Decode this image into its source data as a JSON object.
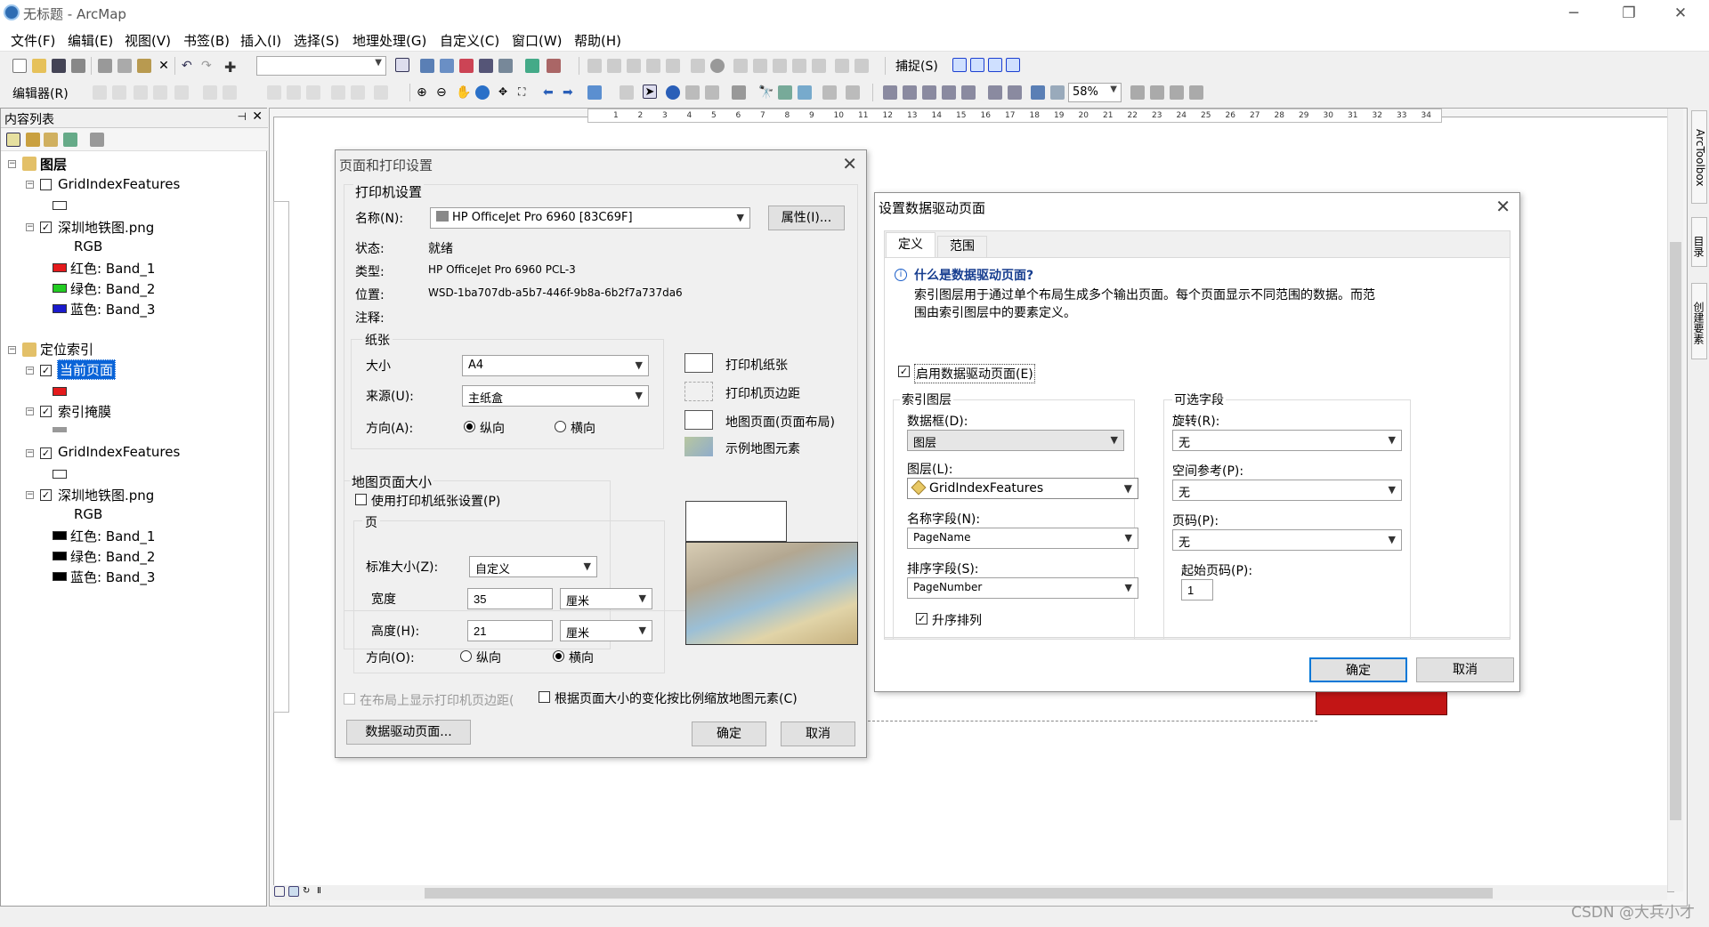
{
  "app": {
    "title": "无标题 - ArcMap",
    "watermark": "CSDN @大兵小才"
  },
  "menu": [
    "文件(F)",
    "编辑(E)",
    "视图(V)",
    "书签(B)",
    "插入(I)",
    "选择(S)",
    "地理处理(G)",
    "自定义(C)",
    "窗口(W)",
    "帮助(H)"
  ],
  "toolbar": {
    "snap_label": "捕捉(S)",
    "editor_label": "编辑器(R)",
    "zoom": "58%"
  },
  "toc": {
    "title": "内容列表",
    "items": [
      {
        "text": "图层",
        "type": "group"
      },
      {
        "text": "GridIndexFeatures"
      },
      {
        "text": "深圳地铁图.png"
      },
      {
        "text": "RGB"
      },
      {
        "text": "红色:   Band_1",
        "color": "#e41a1c"
      },
      {
        "text": "绿色: Band_2",
        "color": "#22cc22"
      },
      {
        "text": "蓝色:   Band_3",
        "color": "#1a1acc"
      },
      {
        "text": "定位索引",
        "type": "group"
      },
      {
        "text": "当前页面",
        "selected": true
      },
      {
        "text": "索引掩膜"
      },
      {
        "text": "GridIndexFeatures"
      },
      {
        "text": "深圳地铁图.png"
      },
      {
        "text": "RGB"
      },
      {
        "text": "红色:    Band_1",
        "color": "#000000"
      },
      {
        "text": "绿色: Band_2",
        "color": "#000000"
      },
      {
        "text": "蓝色:    Band_3",
        "color": "#000000"
      }
    ]
  },
  "ruler": [
    "1",
    "2",
    "3",
    "4",
    "5",
    "6",
    "7",
    "8",
    "9",
    "10",
    "11",
    "12",
    "13",
    "14",
    "15",
    "16",
    "17",
    "18",
    "19",
    "20",
    "21",
    "22",
    "23",
    "24",
    "25",
    "26",
    "27",
    "28",
    "29",
    "30",
    "31",
    "32",
    "33",
    "34"
  ],
  "page_setup": {
    "title": "页面和打印设置",
    "printer_group": "打印机设置",
    "name_label": "名称(N):",
    "name_value": "HP OfficeJet Pro 6960 [83C69F]",
    "properties_btn": "属性(I)...",
    "status_label": "状态:",
    "status_value": "就绪",
    "type_label": "类型:",
    "type_value": "HP OfficeJet Pro 6960 PCL-3",
    "location_label": "位置:",
    "location_value": "WSD-1ba707db-a5b7-446f-9b8a-6b2f7a737da6",
    "comment_label": "注释:",
    "paper_group": "纸张",
    "size_label": "大小",
    "size_value": "A4",
    "source_label": "来源(U):",
    "source_value": "主纸盒",
    "orient_label": "方向(A):",
    "portrait": "纵向",
    "landscape": "横向",
    "legend": [
      "打印机纸张",
      "打印机页边距",
      "地图页面(页面布局)",
      "示例地图元素"
    ],
    "map_page_group": "地图页面大小",
    "use_printer_paper": "使用打印机纸张设置(P)",
    "page_group": "页",
    "std_size_label": "标准大小(Z):",
    "std_size_value": "自定义",
    "width_label": "宽度",
    "width_value": "35",
    "width_unit": "厘米",
    "height_label": "高度(H):",
    "height_value": "21",
    "height_unit": "厘米",
    "orient2_label": "方向(O):",
    "portrait2": "纵向",
    "landscape2": "横向",
    "show_margins": "在布局上显示打印机页边距(",
    "scale_elements": "根据页面大小的变化按比例缩放地图元素(C)",
    "ddp_btn": "数据驱动页面...",
    "ok": "确定",
    "cancel": "取消"
  },
  "ddp": {
    "title": "设置数据驱动页面",
    "tabs": [
      "定义",
      "范围"
    ],
    "info_title": "什么是数据驱动页面?",
    "info_line1": "索引图层用于通过单个布局生成多个输出页面。每个页面显示不同范围的数据。而范",
    "info_line2": "围由索引图层中的要素定义。",
    "enable": "启用数据驱动页面(E)",
    "index_group": "索引图层",
    "frame_label": "数据框(D):",
    "frame_value": "图层",
    "layer_label": "图层(L):",
    "layer_value": "GridIndexFeatures",
    "name_field_label": "名称字段(N):",
    "name_field_value": "PageName",
    "sort_field_label": "排序字段(S):",
    "sort_field_value": "PageNumber",
    "ascending": "升序排列",
    "optional_group": "可选字段",
    "rotation_label": "旋转(R):",
    "rotation_value": "无",
    "spatial_label": "空间参考(P):",
    "spatial_value": "无",
    "page_num_label": "页码(P):",
    "page_num_value": "无",
    "start_label": "起始页码(P):",
    "start_value": "1",
    "ok": "确定",
    "cancel": "取消"
  },
  "right_tabs": [
    "ArcToolbox",
    "目录",
    "创建要素"
  ]
}
